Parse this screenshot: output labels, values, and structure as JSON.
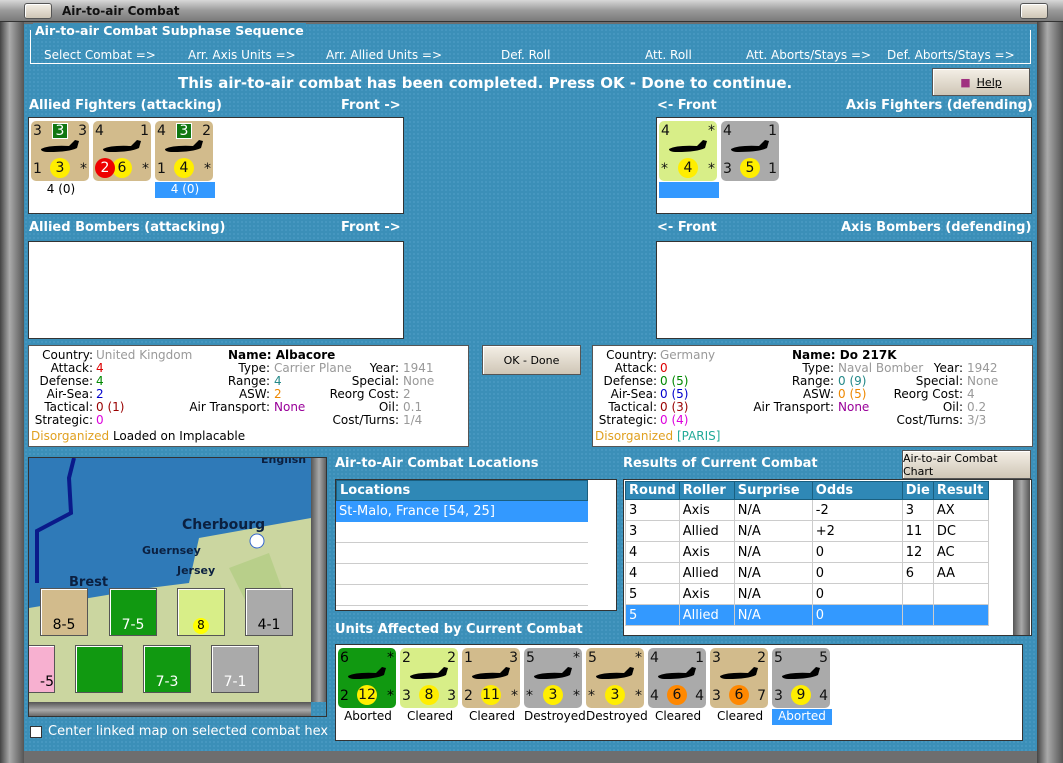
{
  "window": {
    "title": "Air-to-air Combat"
  },
  "sequence": {
    "legend": "Air-to-air Combat Subphase Sequence",
    "steps": [
      "Select Combat =>",
      "Arr. Axis Units =>",
      "Arr. Allied Units =>",
      "Def. Roll",
      "Att. Roll",
      "Att. Aborts/Stays =>",
      "Def. Aborts/Stays =>"
    ]
  },
  "message": "This air-to-air combat has been completed.  Press OK - Done to continue.",
  "help_label": "Help",
  "ok_label": "OK - Done",
  "chart_button": "Air-to-air Combat Chart",
  "sections": {
    "allied_fighters": "Allied Fighters (attacking)",
    "allied_bombers": "Allied Bombers (attacking)",
    "axis_fighters": "Axis Fighters (defending)",
    "axis_bombers": "Axis Bombers (defending)",
    "front_right": "Front ->",
    "front_left": "<- Front"
  },
  "allied_fighters": [
    {
      "bg": "#d2bb8c",
      "tl": "3",
      "tr": "3",
      "bl": "1",
      "mid": "3",
      "br": "*",
      "badge": "3",
      "label": "4 (0)",
      "selected": false
    },
    {
      "bg": "#d2bb8c",
      "tl": "4",
      "tr": "1",
      "bl": "",
      "mid": "6",
      "br": "*",
      "red": "2",
      "label": "",
      "selected": false
    },
    {
      "bg": "#d2bb8c",
      "tl": "4",
      "tr": "2",
      "bl": "1",
      "mid": "4",
      "br": "*",
      "badge": "3",
      "label": "4 (0)",
      "selected": true
    }
  ],
  "axis_fighters": [
    {
      "bg": "#d8ee88",
      "tl": "4",
      "tr": "*",
      "bl": "*",
      "mid": "4",
      "br": "*",
      "label": "",
      "selected": true
    },
    {
      "bg": "#aaaaaa",
      "tl": "4",
      "tr": "1",
      "bl": "3",
      "mid": "5",
      "br": "1",
      "white_tl": true,
      "label": "",
      "selected": false
    }
  ],
  "allied_info": {
    "country_k": "Country:",
    "country": "United Kingdom",
    "attack": "4",
    "defense": "4",
    "air_sea": "2",
    "tactical": "0 (1)",
    "strategic": "0",
    "name": "Name: Albacore",
    "type": "Carrier Plane",
    "range": "4",
    "asw": "2",
    "air_transport": "None",
    "year": "1941",
    "special": "None",
    "reorg": "2",
    "oil": "0.1",
    "cost": "1/4",
    "status": "Disorganized",
    "note": "Loaded on Implacable"
  },
  "axis_info": {
    "country_k": "Country:",
    "country": "Germany",
    "attack": "0",
    "defense": "0 (5)",
    "air_sea": "0 (5)",
    "tactical": "0 (3)",
    "strategic": "0 (4)",
    "name": "Name: Do 217K",
    "type": "Naval Bomber",
    "range": "0 (9)",
    "asw": "0 (5)",
    "air_transport": "None",
    "year": "1942",
    "special": "None",
    "reorg": "4",
    "oil": "0.2",
    "cost": "3/3",
    "status": "Disorganized",
    "note": "[PARIS]"
  },
  "info_keys": {
    "attack": "Attack:",
    "defense": "Defense:",
    "air_sea": "Air-Sea:",
    "tactical": "Tactical:",
    "strategic": "Strategic:",
    "type": "Type:",
    "range": "Range:",
    "asw": "ASW:",
    "air_transport": "Air Transport:",
    "year": "Year:",
    "special": "Special:",
    "reorg": "Reorg Cost:",
    "oil": "Oil:",
    "cost": "Cost/Turns:"
  },
  "map": {
    "labels": [
      "Cherbourg",
      "Guernsey",
      "Jersey",
      "Brest",
      "English"
    ],
    "counters": [
      "8-5",
      "7-5",
      "7-3",
      "7-1",
      "4-1",
      "-5"
    ],
    "checkbox": "Center linked map on selected combat hex",
    "checked": false
  },
  "locations": {
    "title": "Air-to-Air Combat Locations",
    "header": "Locations",
    "items": [
      "St-Malo, France [54, 25]"
    ]
  },
  "results": {
    "title": "Results of Current Combat",
    "columns": [
      "Round",
      "Roller",
      "Surprise",
      "Odds",
      "Die",
      "Result"
    ],
    "rows": [
      [
        "3",
        "Axis",
        "N/A",
        "-2",
        "3",
        "AX"
      ],
      [
        "3",
        "Allied",
        "N/A",
        "+2",
        "11",
        "DC"
      ],
      [
        "4",
        "Axis",
        "N/A",
        "0",
        "12",
        "AC"
      ],
      [
        "4",
        "Allied",
        "N/A",
        "0",
        "6",
        "AA"
      ],
      [
        "5",
        "Axis",
        "N/A",
        "0",
        "",
        ""
      ],
      [
        "5",
        "Allied",
        "N/A",
        "0",
        "",
        ""
      ]
    ],
    "selected_row": 5
  },
  "affected": {
    "title": "Units Affected by Current Combat",
    "units": [
      {
        "bg": "#119911",
        "tl": "6",
        "tr": "*",
        "bl": "2",
        "mid": "12",
        "br": "*",
        "label": "Aborted"
      },
      {
        "bg": "#d8ee88",
        "tl": "2",
        "tr": "2",
        "bl": "3",
        "mid": "8",
        "br": "3",
        "label": "Cleared"
      },
      {
        "bg": "#d2bb8c",
        "tl": "1",
        "tr": "3",
        "bl": "2",
        "mid": "11",
        "br": "*",
        "label": "Cleared"
      },
      {
        "bg": "#aaaaaa",
        "tl": "5",
        "tr": "*",
        "bl": "*",
        "mid": "3",
        "br": "*",
        "label": "Destroyed"
      },
      {
        "bg": "#d2bb8c",
        "tl": "5",
        "tr": "*",
        "bl": "*",
        "mid": "3",
        "br": "*",
        "label": "Destroyed"
      },
      {
        "bg": "#aaaaaa",
        "tl": "4",
        "tr": "1",
        "bl": "4",
        "mid": "6",
        "br": "4",
        "orange": true,
        "label": "Cleared"
      },
      {
        "bg": "#d2bb8c",
        "tl": "3",
        "tr": "2",
        "bl": "3",
        "mid": "6",
        "br": "7",
        "orange": true,
        "label": "Cleared"
      },
      {
        "bg": "#aaaaaa",
        "tl": "5",
        "tr": "5",
        "bl": "3",
        "mid": "9",
        "br": "4",
        "label": "Aborted",
        "selected": true
      }
    ]
  }
}
